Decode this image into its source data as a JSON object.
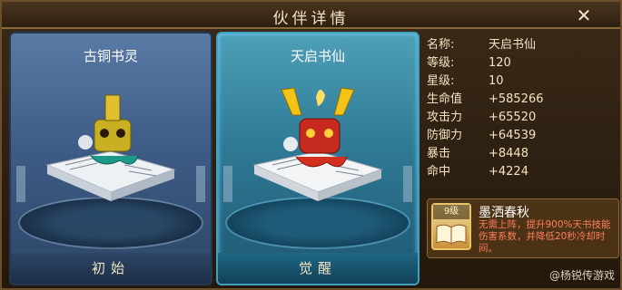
{
  "window": {
    "title": "伙伴详情",
    "close_icon": "close-icon"
  },
  "cards": [
    {
      "name": "古铜书灵",
      "button": "初始"
    },
    {
      "name": "天启书仙",
      "button": "觉醒"
    }
  ],
  "stats": [
    {
      "label": "名称:",
      "value": "天启书仙"
    },
    {
      "label": "等级:",
      "value": "120"
    },
    {
      "label": "星级:",
      "value": "10"
    },
    {
      "label": "生命值",
      "value": "+585266"
    },
    {
      "label": "攻击力",
      "value": "+65520"
    },
    {
      "label": "防御力",
      "value": "+64539"
    },
    {
      "label": "暴击",
      "value": "+8448"
    },
    {
      "label": "命中",
      "value": "+4224"
    }
  ],
  "skill": {
    "level": "9级",
    "name": "墨洒春秋",
    "description": "无需上阵，提升900%天书技能伤害系数，并降低20秒冷却时间。",
    "icon": "open-book-icon"
  },
  "watermark": "@杨锐传游戏",
  "colors": {
    "accent": "#f3e3c2",
    "skill_desc": "#ff7d5c"
  }
}
